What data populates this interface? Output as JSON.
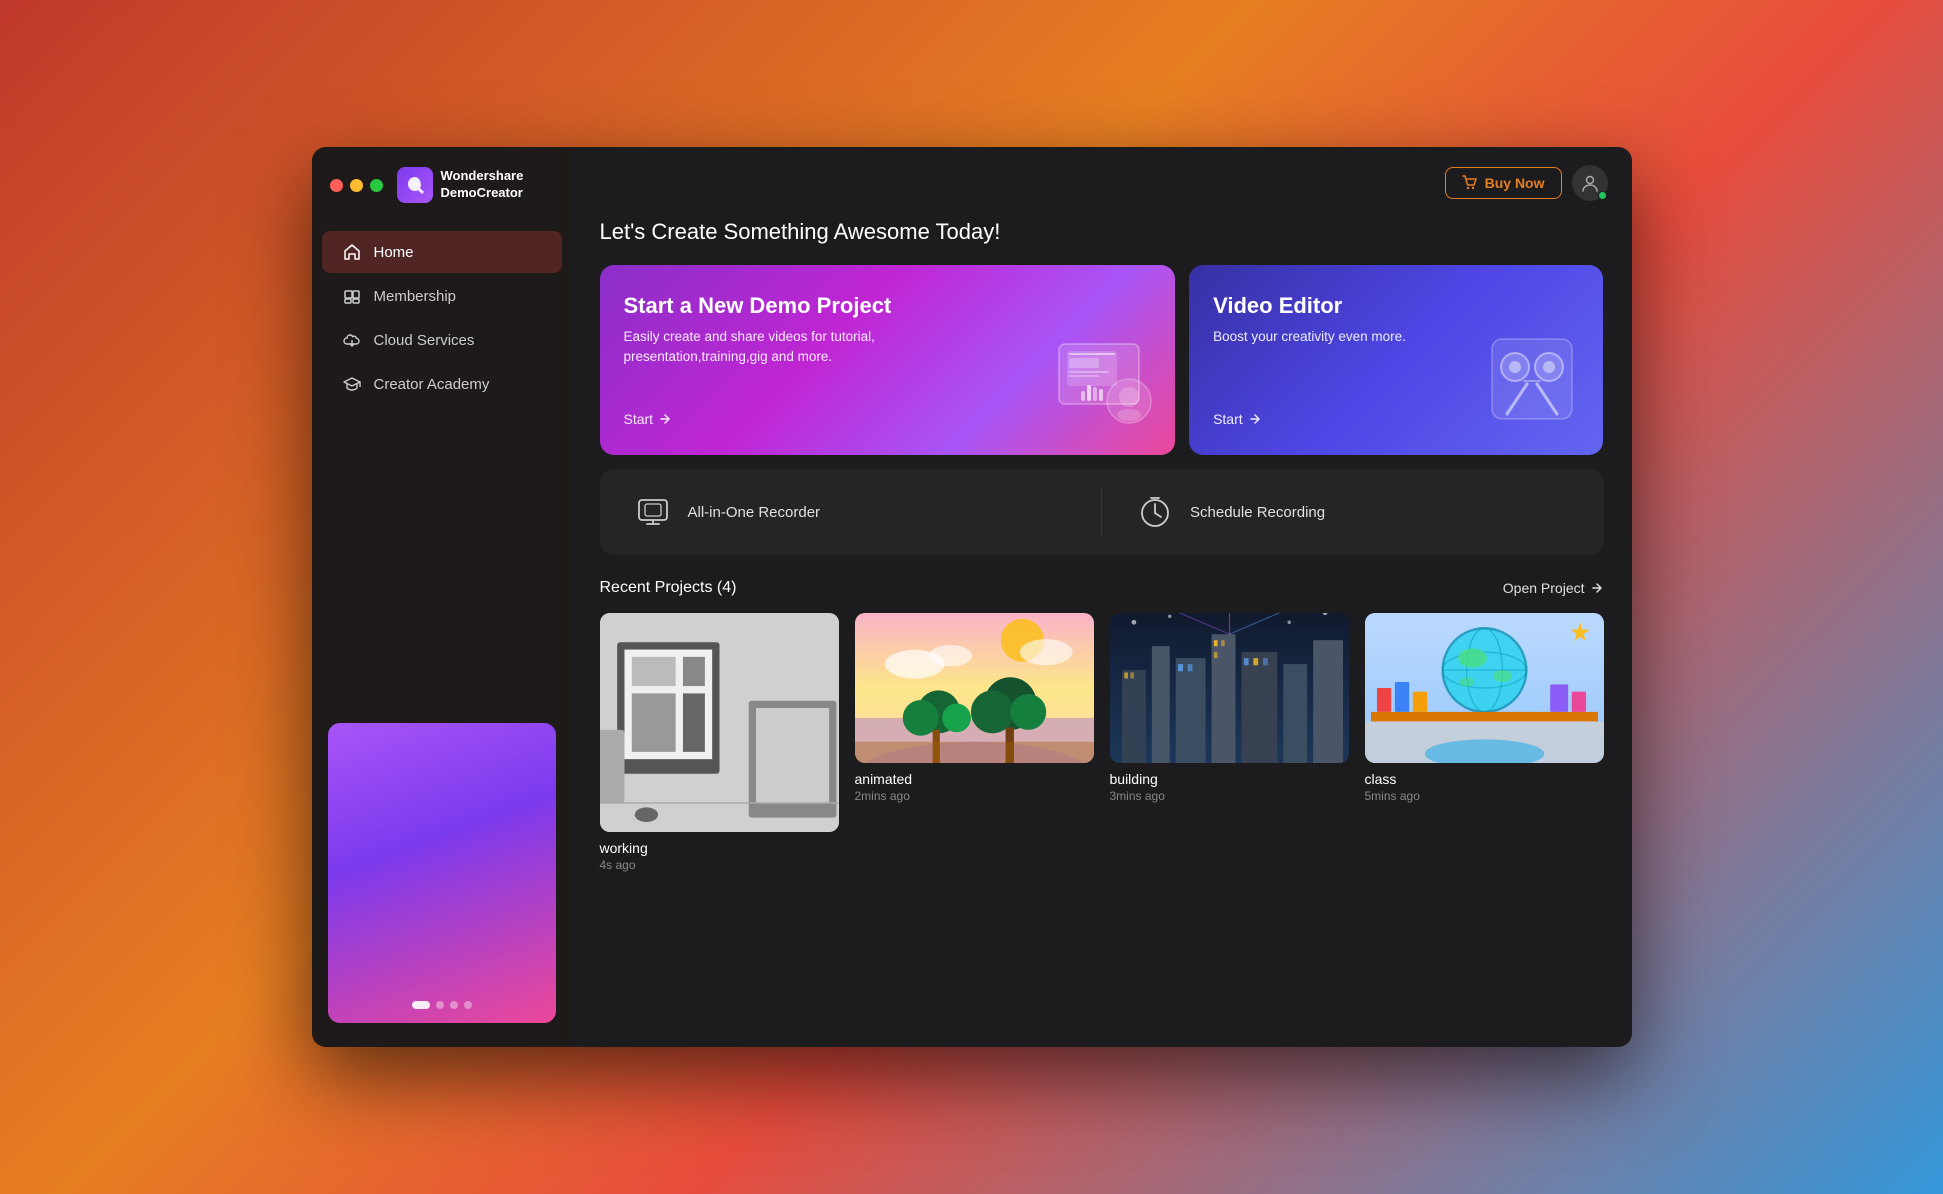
{
  "app": {
    "name_line1": "Wondershare",
    "name_line2": "DemoCreator"
  },
  "header": {
    "buy_now_label": "Buy Now",
    "page_title": "Let's Create Something Awesome Today!"
  },
  "nav": {
    "items": [
      {
        "id": "home",
        "label": "Home",
        "active": true
      },
      {
        "id": "membership",
        "label": "Membership",
        "active": false
      },
      {
        "id": "cloud-services",
        "label": "Cloud Services",
        "active": false
      },
      {
        "id": "creator-academy",
        "label": "Creator Academy",
        "active": false
      }
    ]
  },
  "hero_cards": {
    "left": {
      "title": "Start a New Demo Project",
      "description": "Easily create and share videos for tutorial, presentation,training,gig and more.",
      "start_label": "Start"
    },
    "right": {
      "title": "Video Editor",
      "description": "Boost your creativity even more.",
      "start_label": "Start"
    }
  },
  "recorder": {
    "all_in_one_label": "All-in-One Recorder",
    "schedule_label": "Schedule Recording"
  },
  "recent_projects": {
    "title": "Recent Projects (4)",
    "open_project_label": "Open Project",
    "items": [
      {
        "id": "working",
        "name": "working",
        "time": "4s ago"
      },
      {
        "id": "animated",
        "name": "animated",
        "time": "2mins ago"
      },
      {
        "id": "building",
        "name": "building",
        "time": "3mins ago"
      },
      {
        "id": "class",
        "name": "class",
        "time": "5mins ago"
      }
    ]
  },
  "colors": {
    "accent_orange": "#e67e22",
    "accent_purple": "#a855f7",
    "active_nav_bg": "rgba(180,60,60,0.35)",
    "online_green": "#22c55e"
  }
}
